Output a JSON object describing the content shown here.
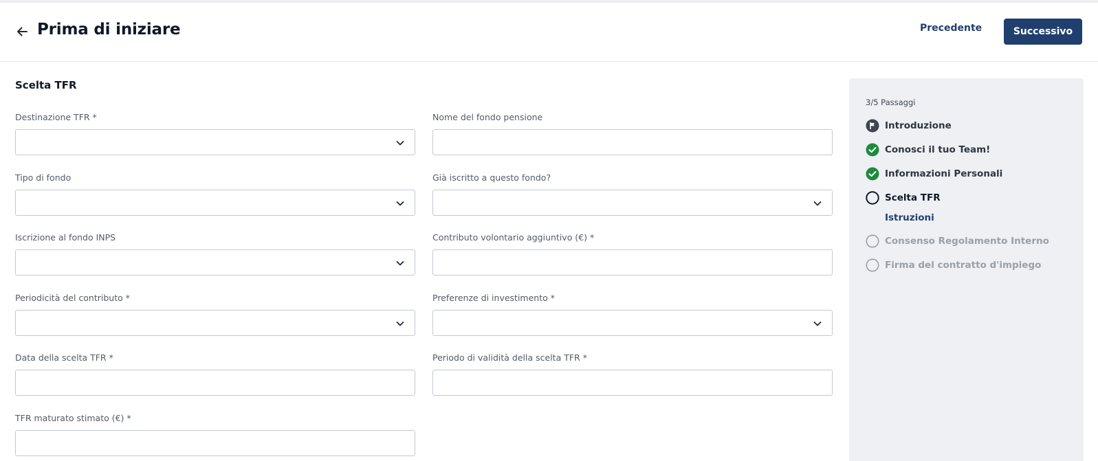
{
  "header": {
    "title": "Prima di iniziare",
    "prev_label": "Precedente",
    "next_label": "Successivo"
  },
  "form": {
    "section_title": "Scelta TFR",
    "fields": [
      {
        "label": "Destinazione TFR *",
        "type": "select",
        "value": ""
      },
      {
        "label": "Nome del fondo pensione",
        "type": "text",
        "value": ""
      },
      {
        "label": "Tipo di fondo",
        "type": "select",
        "value": ""
      },
      {
        "label": "Già iscritto a questo fondo?",
        "type": "select",
        "value": ""
      },
      {
        "label": "Iscrizione al fondo INPS",
        "type": "select",
        "value": ""
      },
      {
        "label": "Contributo volontario aggiuntivo (€) *",
        "type": "text",
        "value": ""
      },
      {
        "label": "Periodicità del contributo *",
        "type": "select",
        "value": ""
      },
      {
        "label": "Preferenze di investimento *",
        "type": "select",
        "value": ""
      },
      {
        "label": "Data della scelta TFR *",
        "type": "text",
        "value": ""
      },
      {
        "label": "Periodo di validità della scelta TFR *",
        "type": "text",
        "value": ""
      },
      {
        "label": "TFR maturato stimato (€) *",
        "type": "text",
        "value": ""
      }
    ]
  },
  "progress": {
    "count_label": "3/5 Passaggi",
    "steps": [
      {
        "label": "Introduzione",
        "status": "flag"
      },
      {
        "label": "Conosci il tuo Team!",
        "status": "done"
      },
      {
        "label": "Informazioni Personali",
        "status": "done"
      },
      {
        "label": "Scelta TFR",
        "status": "current"
      },
      {
        "label": "Consenso Regolamento Interno",
        "status": "pending"
      },
      {
        "label": "Firma del contratto d'impiego",
        "status": "pending"
      }
    ],
    "current_substep": "Istruzioni"
  },
  "colors": {
    "primary": "#213f6e",
    "done_green": "#1e8a3c",
    "panel_bg": "#eef0f3"
  }
}
